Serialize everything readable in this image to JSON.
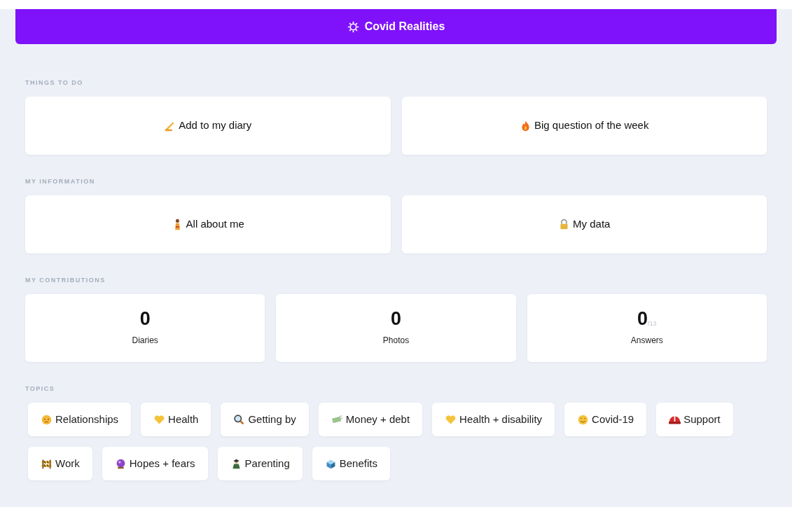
{
  "header": {
    "title": "Covid Realities"
  },
  "sections": [
    {
      "heading": "THINGS TO DO",
      "kind": "links",
      "items": [
        {
          "label": "Add to my diary"
        },
        {
          "label": "Big question of the week"
        }
      ]
    },
    {
      "heading": "MY INFORMATION",
      "kind": "links",
      "items": [
        {
          "label": "All about me"
        },
        {
          "label": "My data"
        }
      ]
    },
    {
      "heading": "MY CONTRIBUTIONS",
      "kind": "stats",
      "items": [
        {
          "value": "0",
          "label": "Diaries"
        },
        {
          "value": "0",
          "label": "Photos"
        },
        {
          "value": "0",
          "total": "/13",
          "label": "Answers"
        }
      ]
    },
    {
      "heading": "TOPICS",
      "kind": "topics",
      "items": [
        {
          "label": "Relationships"
        },
        {
          "label": "Health"
        },
        {
          "label": "Getting by"
        },
        {
          "label": "Money + debt"
        },
        {
          "label": "Health + disability"
        },
        {
          "label": "Covid-19"
        },
        {
          "label": "Support"
        },
        {
          "label": "Work"
        },
        {
          "label": "Hopes + fears"
        },
        {
          "label": "Parenting"
        },
        {
          "label": "Benefits"
        }
      ]
    }
  ]
}
